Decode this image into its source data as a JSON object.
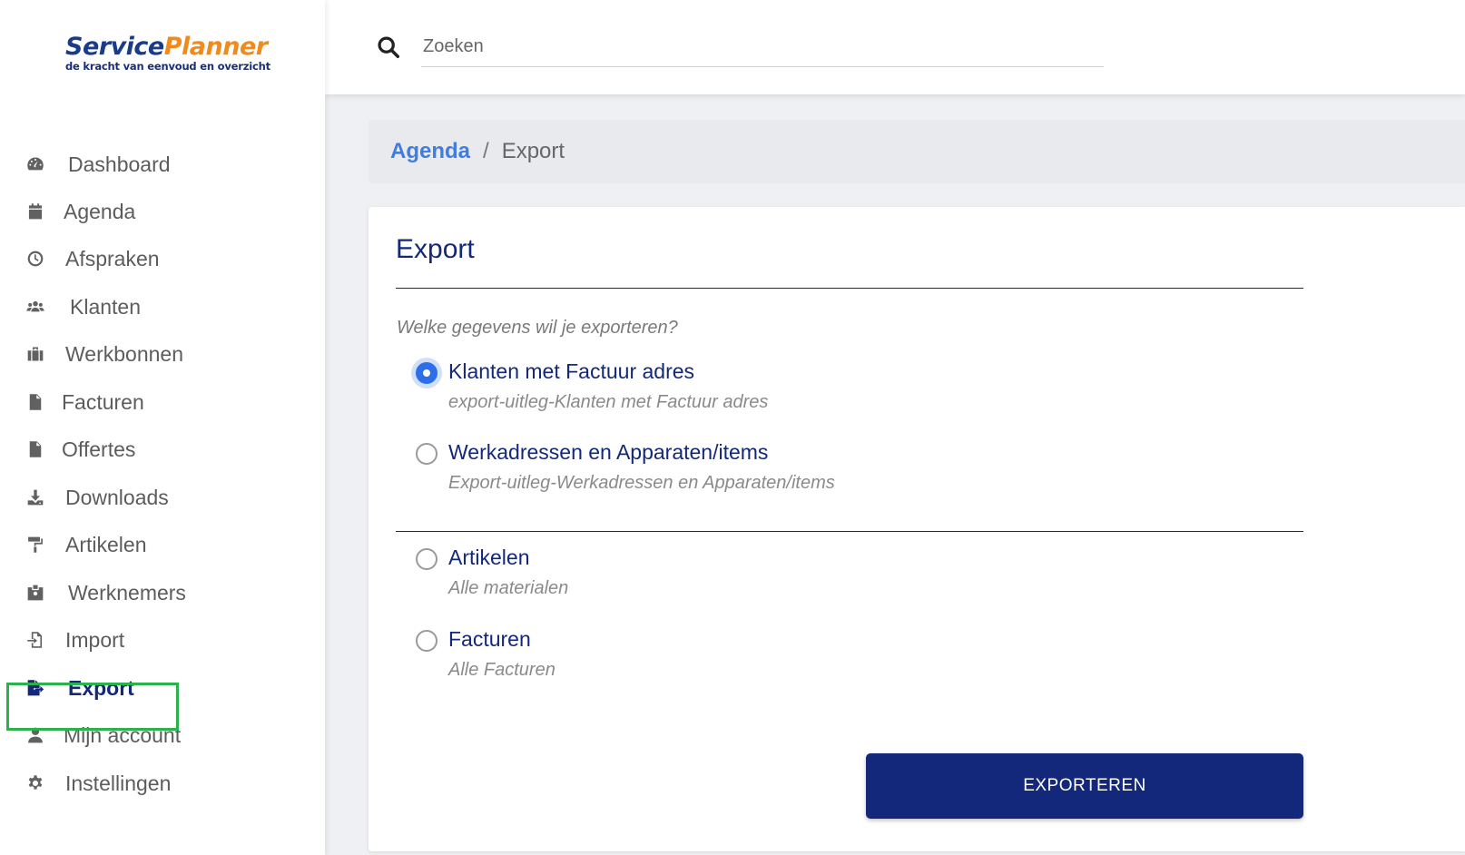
{
  "brand": {
    "name_part1": "Service",
    "name_part2": "Planner",
    "tagline": "de kracht van eenvoud en overzicht",
    "color_primary": "#1a3a8a",
    "color_accent": "#f08a1c"
  },
  "search": {
    "placeholder": "Zoeken",
    "icon": "search-icon"
  },
  "sidebar": {
    "items": [
      {
        "label": "Dashboard",
        "icon": "dashboard-gauge-icon"
      },
      {
        "label": "Agenda",
        "icon": "calendar-icon"
      },
      {
        "label": "Afspraken",
        "icon": "clock-icon"
      },
      {
        "label": "Klanten",
        "icon": "users-icon"
      },
      {
        "label": "Werkbonnen",
        "icon": "briefcase-icon"
      },
      {
        "label": "Facturen",
        "icon": "invoice-icon"
      },
      {
        "label": "Offertes",
        "icon": "quote-icon"
      },
      {
        "label": "Downloads",
        "icon": "download-icon"
      },
      {
        "label": "Artikelen",
        "icon": "paint-roller-icon"
      },
      {
        "label": "Werknemers",
        "icon": "id-badge-icon"
      },
      {
        "label": "Import",
        "icon": "file-import-icon"
      },
      {
        "label": "Export",
        "icon": "file-export-icon",
        "active": true
      },
      {
        "label": "Mijn account",
        "icon": "user-icon"
      },
      {
        "label": "Instellingen",
        "icon": "gear-icon"
      }
    ]
  },
  "breadcrumb": {
    "parent": "Agenda",
    "separator": "/",
    "current": "Export"
  },
  "card": {
    "title": "Export",
    "question": "Welke gegevens wil je exporteren?",
    "options": [
      {
        "label": "Klanten met Factuur adres",
        "description": "export-uitleg-Klanten met Factuur adres",
        "checked": true
      },
      {
        "label": "Werkadressen en Apparaten/items",
        "description": "Export-uitleg-Werkadressen en Apparaten/items",
        "checked": false
      },
      {
        "label": "Artikelen",
        "description": "Alle materialen",
        "checked": false
      },
      {
        "label": "Facturen",
        "description": "Alle Facturen",
        "checked": false
      }
    ],
    "button_label": "EXPORTEREN"
  },
  "colors": {
    "navy": "#13287a",
    "link_blue": "#3f7de0",
    "radio_blue": "#2c6fe8",
    "active_outline": "#2bb24c"
  }
}
